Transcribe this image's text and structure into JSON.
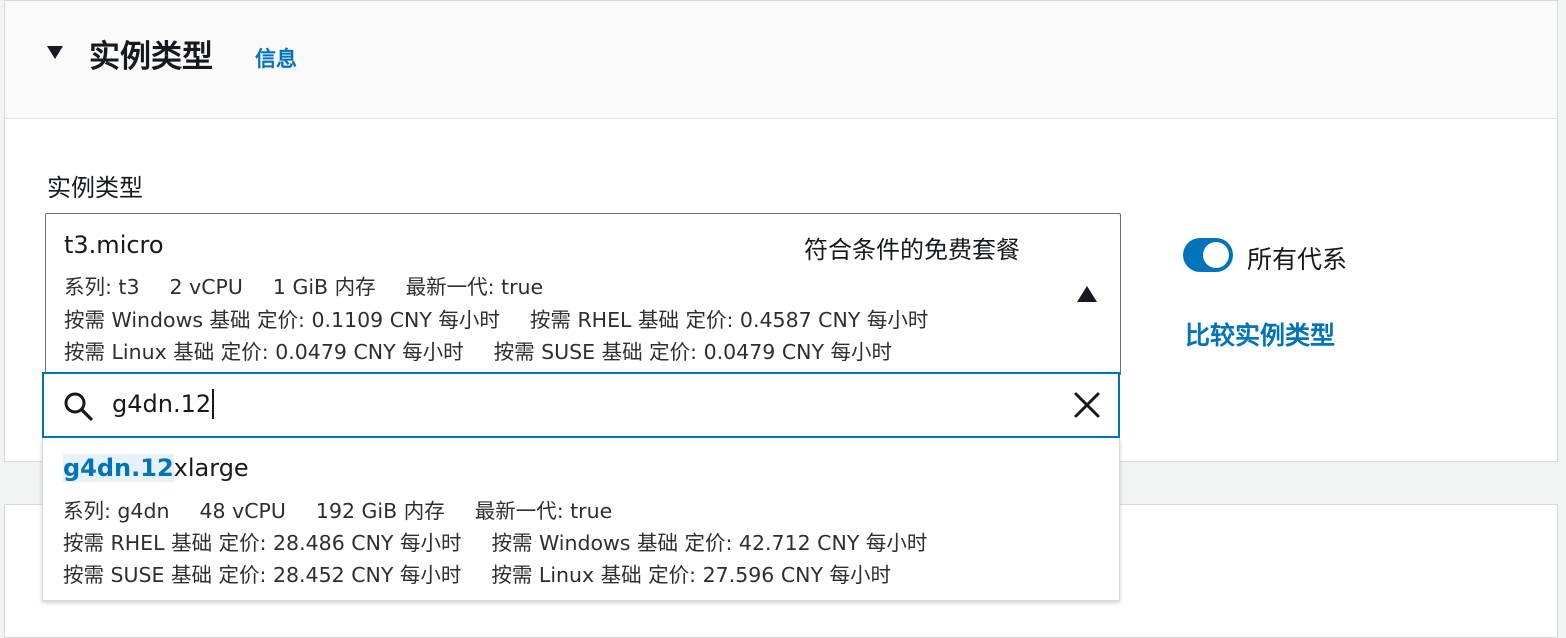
{
  "section": {
    "title": "实例类型",
    "info_link": "信息"
  },
  "field": {
    "label": "实例类型"
  },
  "selected": {
    "name": "t3.micro",
    "badge": "符合条件的免费套餐",
    "specs": [
      "系列: t3",
      "2 vCPU",
      "1 GiB 内存",
      "最新一代: true"
    ],
    "pricing_row1": [
      "按需 Windows 基础 定价: 0.1109 CNY 每小时",
      "按需 RHEL 基础 定价: 0.4587 CNY 每小时"
    ],
    "pricing_row2": [
      "按需 Linux 基础 定价: 0.0479 CNY 每小时",
      "按需 SUSE 基础 定价: 0.0479 CNY 每小时"
    ]
  },
  "search": {
    "value": "g4dn.12"
  },
  "options": [
    {
      "name_match": "g4dn.12",
      "name_rest": "xlarge",
      "specs": [
        "系列: g4dn",
        "48 vCPU",
        "192 GiB 内存",
        "最新一代: true"
      ],
      "pricing_row1": [
        "按需 RHEL 基础 定价: 28.486 CNY 每小时",
        "按需 Windows 基础 定价: 42.712 CNY 每小时"
      ],
      "pricing_row2": [
        "按需 SUSE 基础 定价: 28.452 CNY 每小时",
        "按需 Linux 基础 定价: 27.596 CNY 每小时"
      ]
    }
  ],
  "toggle": {
    "label": "所有代系",
    "on": true
  },
  "compare_link": "比较实例类型",
  "colors": {
    "accent": "#0073bb",
    "text": "#16191f",
    "border": "#687078"
  }
}
